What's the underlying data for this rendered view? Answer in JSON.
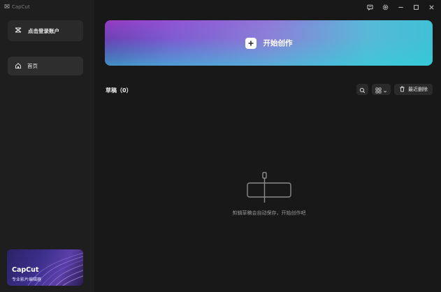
{
  "app": {
    "title": "CapCut"
  },
  "sidebar": {
    "login_label": "点击登录账户",
    "nav_home_label": "首页",
    "promo": {
      "title": "CapCut",
      "subtitle": "专业影片编辑器"
    }
  },
  "window_controls": {
    "icons": [
      "feedback-icon",
      "settings-icon",
      "minimize-icon",
      "maximize-icon",
      "close-icon"
    ]
  },
  "main": {
    "create_label": "开始创作",
    "drafts_title": "草稿（0）",
    "trash_label": "最近删除",
    "empty_message": "剪辑草稿会自动保存，开始创作吧"
  },
  "colors": {
    "background": "#181818",
    "sidebar": "#1e1e1e",
    "button": "#2a2a2a",
    "banner_start": "#5a3aa8",
    "banner_end": "#3fc0d6"
  }
}
